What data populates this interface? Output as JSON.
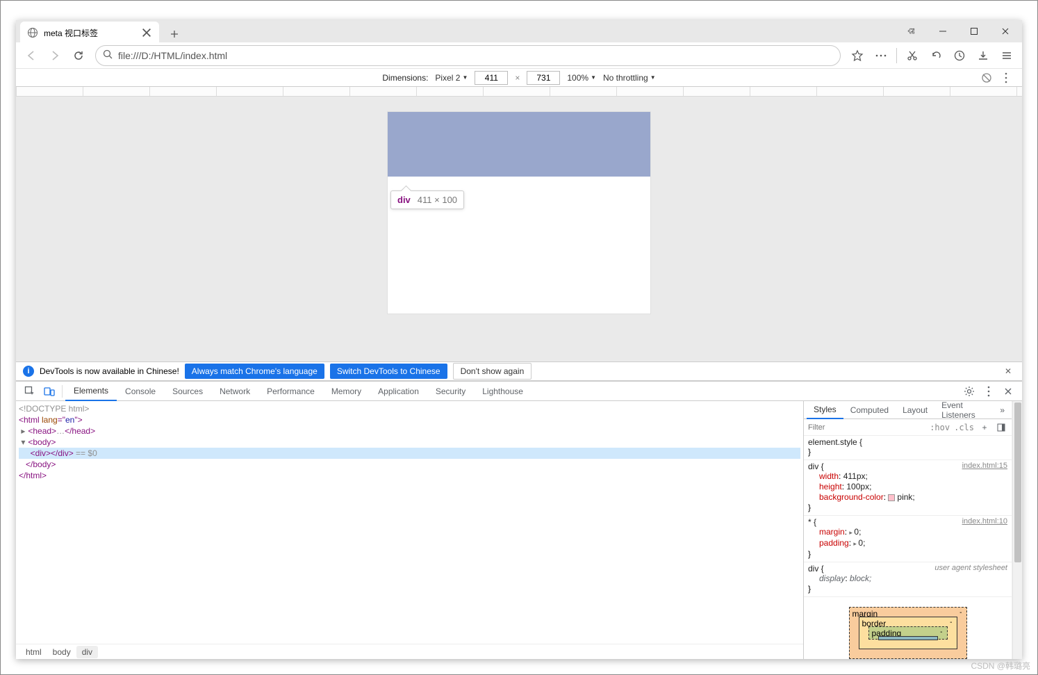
{
  "browser_tab": {
    "title": "meta 视口标签"
  },
  "url": "file:///D:/HTML/index.html",
  "device_bar": {
    "dimensions_label": "Dimensions:",
    "device": "Pixel 2",
    "width": "411",
    "height": "731",
    "zoom": "100%",
    "throttling": "No throttling"
  },
  "inspect_tooltip": {
    "tag": "div",
    "dims": "411 × 100"
  },
  "locale_banner": {
    "msg": "DevTools is now available in Chinese!",
    "btn1": "Always match Chrome's language",
    "btn2": "Switch DevTools to Chinese",
    "btn3": "Don't show again"
  },
  "devtools_tabs": [
    "Elements",
    "Console",
    "Sources",
    "Network",
    "Performance",
    "Memory",
    "Application",
    "Security",
    "Lighthouse"
  ],
  "dom": {
    "doctype": "<!DOCTYPE html>",
    "html_open": "<html lang=\"en\">",
    "head_collapsed": "<head>…</head>",
    "body_open": "<body>",
    "selected": "<div></div>",
    "sel_suffix": " == $0",
    "body_close": "</body>",
    "html_close": "</html>"
  },
  "crumbs": [
    "html",
    "body",
    "div"
  ],
  "styles_tabs": [
    "Styles",
    "Computed",
    "Layout",
    "Event Listeners"
  ],
  "filter_placeholder": "Filter",
  "filter_hov": ":hov",
  "filter_cls": ".cls",
  "rules": {
    "elstyle_sel": "element.style {",
    "close": "}",
    "div_sel": "div {",
    "div_src": "index.html:15",
    "width_n": "width",
    "width_v": "411px;",
    "height_n": "height",
    "height_v": "100px;",
    "bg_n": "background-color",
    "bg_v": "pink;",
    "star_sel": "* {",
    "star_src": "index.html:10",
    "margin_n": "margin",
    "margin_v": "0;",
    "padding_n": "padding",
    "padding_v": "0;",
    "ua_sel": "div {",
    "ua_src": "user agent stylesheet",
    "disp_n": "display",
    "disp_v": "block;"
  },
  "bm": {
    "margin": "margin",
    "border": "border",
    "padding": "padding",
    "dash": "-"
  },
  "watermark": "CSDN @韩璐亮"
}
